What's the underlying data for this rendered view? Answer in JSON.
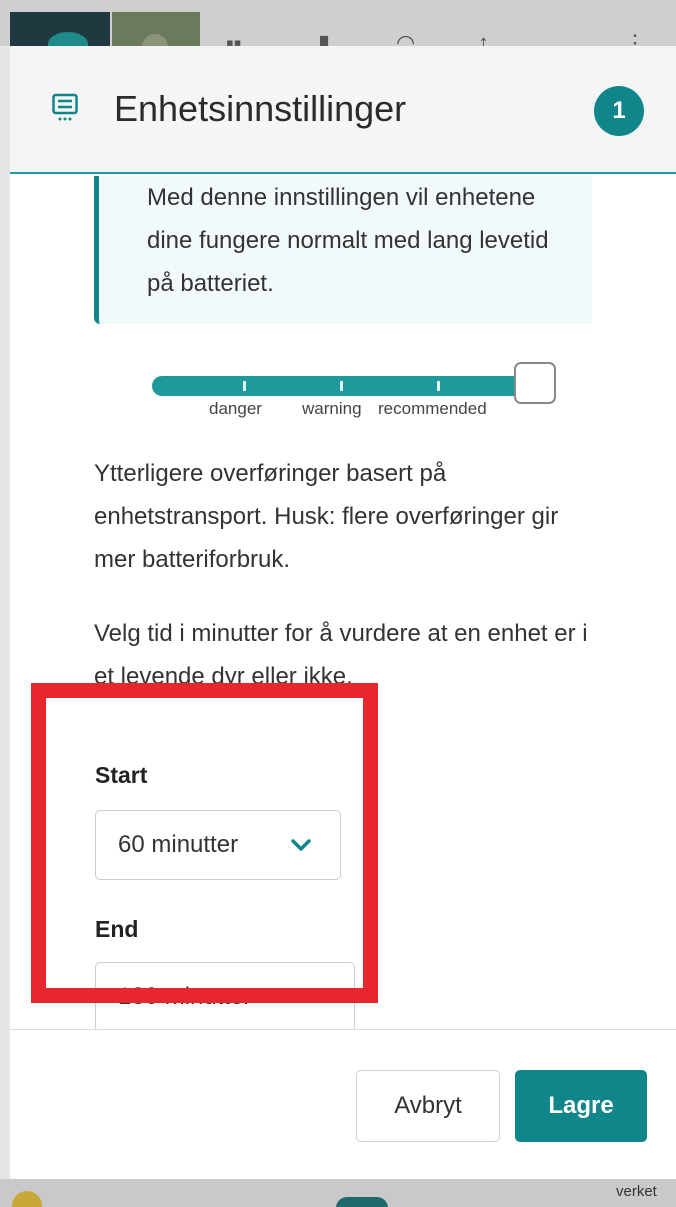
{
  "dialog": {
    "title": "Enhetsinnstillinger",
    "badge": "1"
  },
  "info_box": {
    "text": "Med denne innstillingen vil enhetene dine fungere normalt med lang levetid på batteriet."
  },
  "slider": {
    "labels": [
      "danger",
      "warning",
      "recommended"
    ],
    "value_fraction": 1.0
  },
  "paragraphs": {
    "transfers": "Ytterligere overføringer basert på enhetstransport. Husk: flere overføringer gir mer batteriforbruk.",
    "select_time": "Velg tid i minutter for å vurdere at en enhet er i et levende dyr eller ikke."
  },
  "start": {
    "label": "Start",
    "value": "60 minutter"
  },
  "end": {
    "label": "End",
    "value": "180 minutter"
  },
  "footer": {
    "cancel_label": "Avbryt",
    "save_label": "Lagre"
  },
  "background": {
    "bottom_text": "verket"
  },
  "colors": {
    "accent": "#10868b",
    "highlight_box": "#e8262d"
  }
}
